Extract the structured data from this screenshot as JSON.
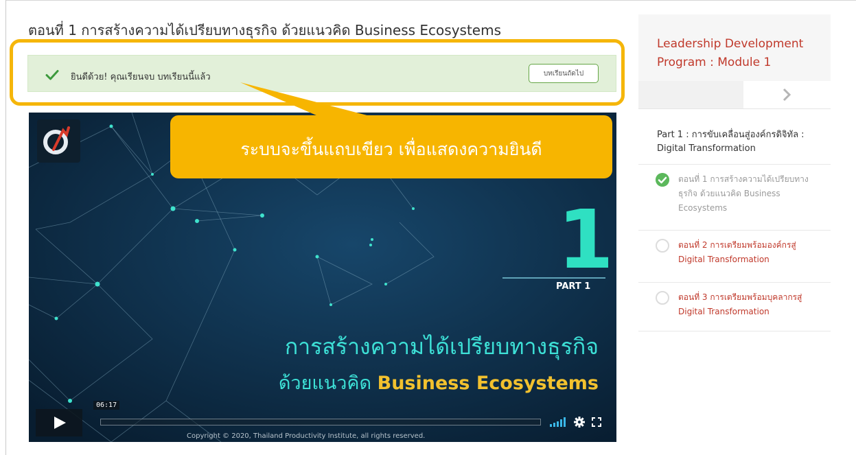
{
  "lesson": {
    "title": "ตอนที่ 1 การสร้างความได้เปรียบทางธุรกิจ ด้วยแนวคิด Business Ecosystems"
  },
  "success_bar": {
    "message": "ยินดีด้วย! คุณเรียนจบ บทเรียนนี้แล้ว",
    "next_button_label": "บทเรียนถัดไป",
    "color": "#e2f0d9"
  },
  "callout": {
    "text": "ระบบจะขึ้นแถบเขียว เพื่อแสดงความยินดี",
    "color": "#f7b500",
    "highlight_color": "#f5b60a"
  },
  "video": {
    "part_number": "1",
    "part_label": "PART 1",
    "title_line1": "การสร้างความได้เปรียบทางธุรกิจ",
    "title_line2_th": "ด้วยแนวคิด",
    "title_line2_en": "Business Ecosystems",
    "copyright": "Copyright © 2020, Thailand Productivity Institute, all rights reserved.",
    "current_time": "06:17",
    "progress": 0.0
  },
  "sidebar": {
    "course_title": "Leadership Development Program : Module 1",
    "section_title": "Part 1 : การขับเคลื่อนสู่องค์กรดิจิทัล : Digital Transformation",
    "lessons": [
      {
        "label": "ตอนที่ 1 การสร้างความได้เปรียบทางธุรกิจ ด้วยแนวคิด Business Ecosystems",
        "completed": true
      },
      {
        "label": "ตอนที่ 2 การเตรียมพร้อมองค์กรสู่ Digital Transformation",
        "completed": false
      },
      {
        "label": "ตอนที่ 3 การเตรียมพร้อมบุคลากรสู่ Digital Transformation",
        "completed": false
      }
    ],
    "accent_color": "#c0392b",
    "check_color": "#5cb85c"
  }
}
